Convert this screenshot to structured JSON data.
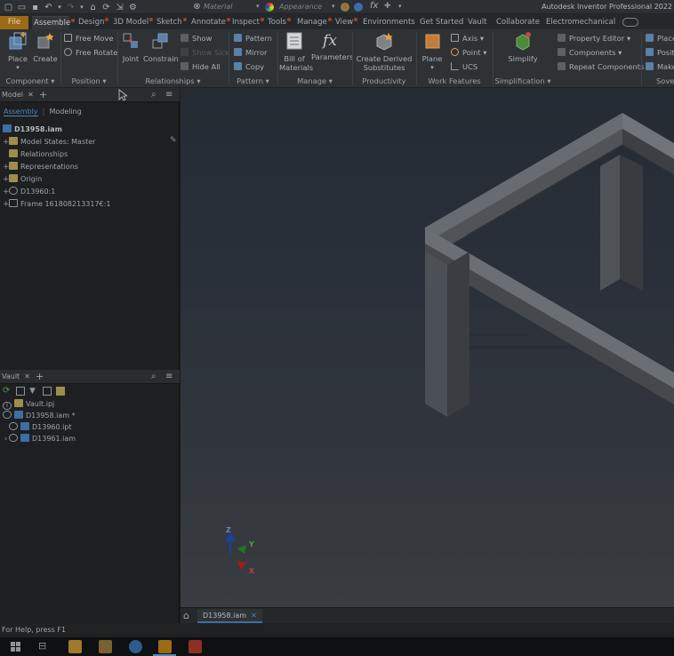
{
  "titlebar": {
    "material_label": "Material",
    "appearance_label": "Appearance",
    "app_title": "Autodesk Inventor Professional 2022"
  },
  "tabs": {
    "file": "File",
    "items": [
      "Assemble",
      "Design",
      "3D Model",
      "Sketch",
      "Annotate",
      "Inspect",
      "Tools",
      "Manage",
      "View",
      "Environments",
      "Get Started",
      "Vault",
      "Collaborate",
      "Electromechanical"
    ],
    "active": "Assemble"
  },
  "ribbon": {
    "component": {
      "label": "Component",
      "place": "Place",
      "create": "Create"
    },
    "position": {
      "label": "Position",
      "free_move": "Free Move",
      "free_rotate": "Free Rotate"
    },
    "relationships": {
      "label": "Relationships",
      "joint": "Joint",
      "constrain": "Constrain",
      "show": "Show",
      "show_sick": "Show Sick",
      "hide_all": "Hide All"
    },
    "pattern": {
      "label": "Pattern",
      "pattern": "Pattern",
      "mirror": "Mirror",
      "copy": "Copy"
    },
    "manage": {
      "label": "Manage",
      "bom_line1": "Bill of",
      "bom_line2": "Materials",
      "parameters": "Parameters",
      "fx": "fx"
    },
    "productivity": {
      "label": "Productivity",
      "line1": "Create Derived",
      "line2": "Substitutes"
    },
    "work_features": {
      "label": "Work Features",
      "plane": "Plane",
      "axis": "Axis",
      "point": "Point",
      "ucs": "UCS"
    },
    "simplification": {
      "label": "Simplification",
      "simplify": "Simplify",
      "property_editor": "Property Editor",
      "components": "Components",
      "repeat_components": "Repeat Components"
    },
    "cut_off": {
      "label": "Sove",
      "place": "Place",
      "position": "Positi",
      "make": "Make"
    }
  },
  "model_panel": {
    "tab_label": "Model",
    "sub_tabs": [
      "Assembly",
      "Modeling"
    ],
    "root": "D13958.iam",
    "items": [
      {
        "label": "Model States: Master",
        "icon": "folder-icon"
      },
      {
        "label": "Relationships",
        "icon": "folder-icon"
      },
      {
        "label": "Representations",
        "icon": "folder-icon"
      },
      {
        "label": "Origin",
        "icon": "folder-icon"
      },
      {
        "label": "D13960:1",
        "icon": "part-icon"
      },
      {
        "label": "Frame 161808213317€:1",
        "icon": "frame-icon"
      }
    ]
  },
  "vault_panel": {
    "tab_label": "Vault",
    "items": [
      {
        "label": "Vault.ipj"
      },
      {
        "label": "D13958.iam *"
      },
      {
        "label": "D13960.ipt"
      },
      {
        "label": "D13961.iam"
      }
    ]
  },
  "viewport": {
    "axis_x": "X",
    "axis_y": "Y",
    "axis_z": "Z"
  },
  "doc_tab": {
    "label": "D13958.iam"
  },
  "status": {
    "help": "For Help, press F1"
  },
  "colors": {
    "file_tab": "#9b6a17",
    "accent_blue": "#3c6fa8",
    "axis_x": "#a01c1c",
    "axis_y": "#1f7a1f",
    "axis_z": "#1d3fa0"
  }
}
